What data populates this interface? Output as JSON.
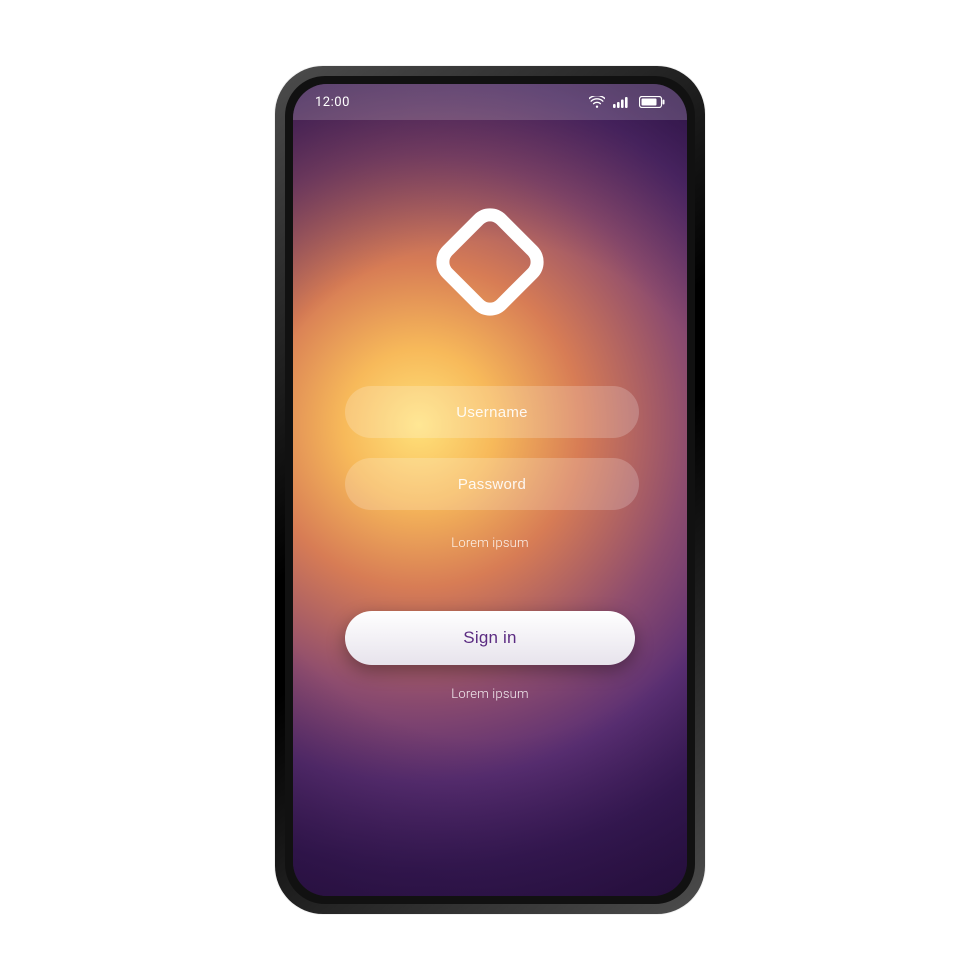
{
  "status": {
    "time": "12:00"
  },
  "logo": {
    "name": "diamond-logo"
  },
  "form": {
    "username_placeholder": "Username",
    "password_placeholder": "Password",
    "helper_text": "Lorem ipsum",
    "signin_label": "Sign in",
    "footer_text": "Lorem ipsum"
  },
  "colors": {
    "accent": "#5b2b82",
    "field_bg": "rgba(255,255,255,0.20)"
  }
}
